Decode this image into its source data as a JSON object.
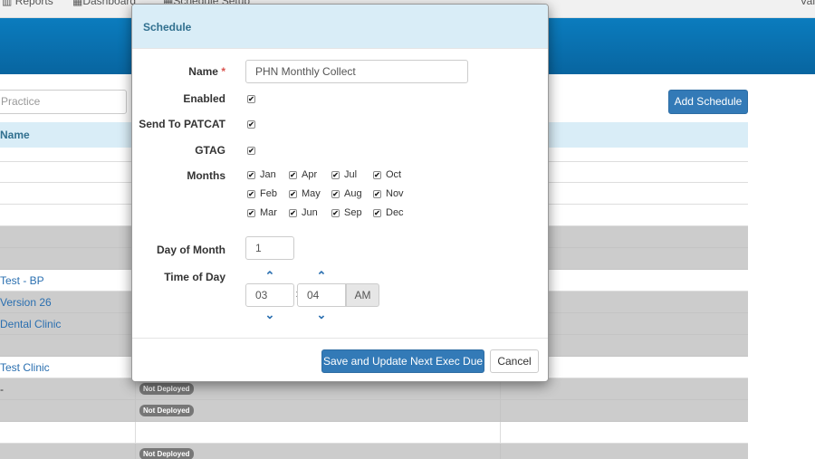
{
  "topnav": {
    "items": [
      "Reports",
      "Dashboard",
      "Schedule Setup"
    ],
    "user": "Val"
  },
  "page": {
    "search_placeholder": "Practice",
    "add_button": "Add Schedule",
    "table_header": "Name"
  },
  "rows": [
    {
      "name": "",
      "badge": "",
      "shaded": false
    },
    {
      "name": "",
      "badge": "",
      "shaded": false
    },
    {
      "name": "",
      "badge": "",
      "shaded": false
    },
    {
      "name": "",
      "badge": "",
      "shaded": true
    },
    {
      "name": "",
      "badge": "",
      "shaded": true
    },
    {
      "name": "Test - BP",
      "badge": "",
      "shaded": false
    },
    {
      "name": "Version 26",
      "badge": "",
      "shaded": true
    },
    {
      "name": "Dental Clinic",
      "badge": "",
      "shaded": true
    },
    {
      "name": "",
      "badge": "",
      "shaded": true
    },
    {
      "name": "Test Clinic",
      "badge": "",
      "shaded": false
    },
    {
      "name": "-",
      "badge": "Not Deployed",
      "shaded": true
    },
    {
      "name": "",
      "badge": "Not Deployed",
      "shaded": true
    },
    {
      "name": "",
      "badge": "",
      "shaded": false
    },
    {
      "name": "",
      "badge": "Not Deployed",
      "shaded": true
    }
  ],
  "modal": {
    "title": "Schedule",
    "name_label": "Name",
    "required_mark": "*",
    "name_value": "PHN Monthly Collect",
    "enabled_label": "Enabled",
    "send_label": "Send To PATCAT",
    "gtag_label": "GTAG",
    "months_label": "Months",
    "months": [
      "Jan",
      "Apr",
      "Jul",
      "Oct",
      "Feb",
      "May",
      "Aug",
      "Nov",
      "Mar",
      "Jun",
      "Sep",
      "Dec"
    ],
    "day_label": "Day of Month",
    "day_value": "1",
    "time_label": "Time of Day",
    "hour": "03",
    "minute": "04",
    "ampm": "AM",
    "save_button": "Save and Update Next Exec Due",
    "cancel_button": "Cancel",
    "check_glyph": "✔",
    "up_glyph": "⌃",
    "down_glyph": "⌄"
  }
}
